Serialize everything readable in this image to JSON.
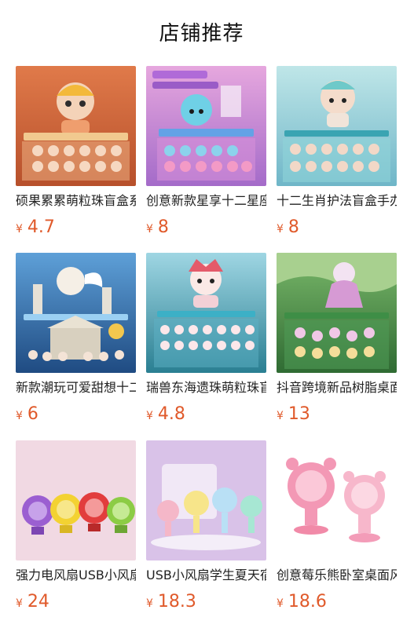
{
  "header": {
    "title": "店铺推荐"
  },
  "currency": "¥",
  "products": [
    {
      "name": "硕果累累萌粒珠盲盒系列",
      "price": "4.7",
      "image": "blind-box-figures"
    },
    {
      "name": "创意新款星享十二星座盲盒",
      "price": "8",
      "image": "blind-box-figures"
    },
    {
      "name": "十二生肖护法盲盒手办",
      "price": "8",
      "image": "blind-box-figures"
    },
    {
      "name": "新款潮玩可爱甜想十二星座",
      "price": "6",
      "image": "blind-box-figures"
    },
    {
      "name": "瑞兽东海遗珠萌粒珠盲盒",
      "price": "4.8",
      "image": "blind-box-figures"
    },
    {
      "name": "抖音跨境新品树脂桌面摆件",
      "price": "13",
      "image": "blind-box-figures"
    },
    {
      "name": "强力电风扇USB小风扇",
      "price": "24",
      "image": "usb-fans"
    },
    {
      "name": "USB小风扇学生夏天宿舍",
      "price": "18.3",
      "image": "usb-fans"
    },
    {
      "name": "创意莓乐熊卧室桌面风扇",
      "price": "18.6",
      "image": "bear-fans"
    }
  ]
}
